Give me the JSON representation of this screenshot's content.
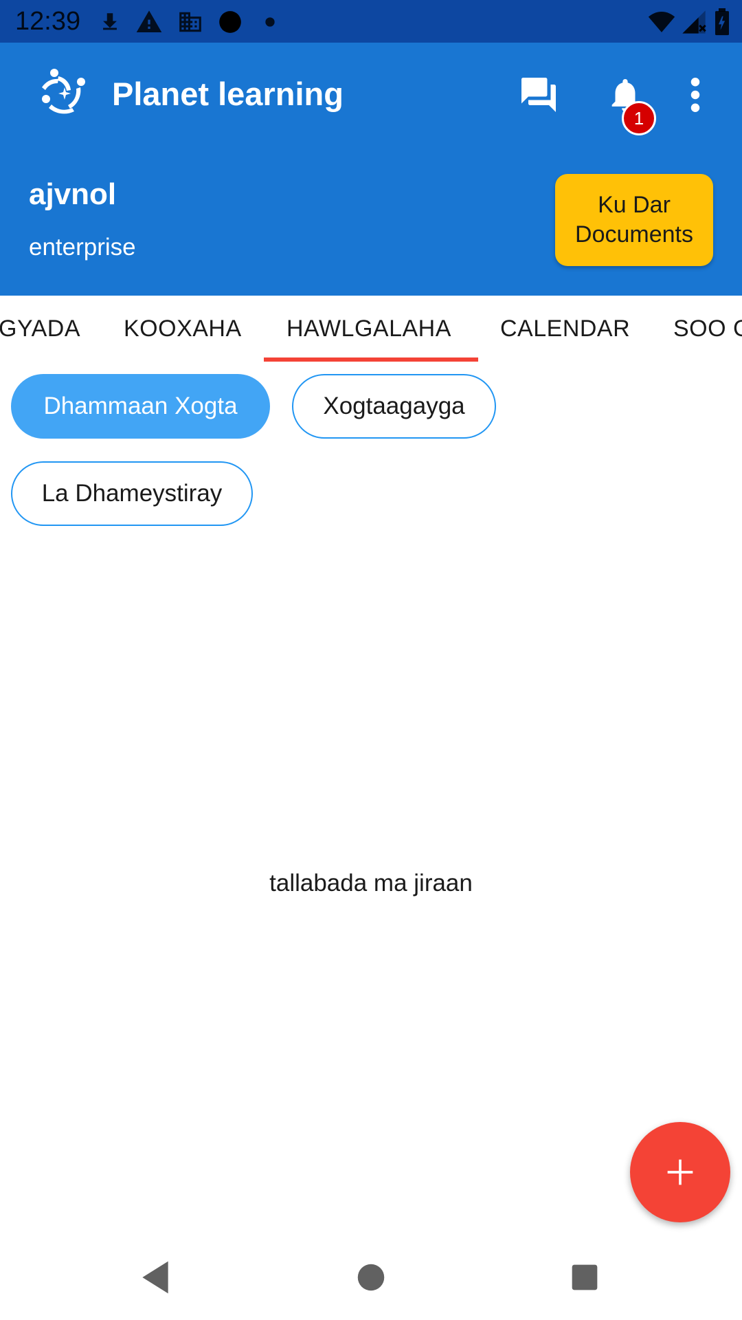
{
  "status_bar": {
    "time": "12:39",
    "icons": [
      "download-icon",
      "warning-icon",
      "building-icon",
      "circle-icon",
      "dot-icon",
      "wifi-icon",
      "signal-icon",
      "battery-icon"
    ]
  },
  "app_bar": {
    "title": "Planet learning",
    "logo_icon": "planet-learning-logo",
    "actions": [
      "chat-icon",
      "notifications-icon",
      "more-vert-icon"
    ],
    "notification_count": "1",
    "username": "ajvnol",
    "plan": "enterprise",
    "documents_button": {
      "line1": "Ku Dar",
      "line2": "Documents"
    }
  },
  "tabs": {
    "items": [
      {
        "label": "GYADA"
      },
      {
        "label": "KOOXAHA"
      },
      {
        "label": "HAWLGALAHA"
      },
      {
        "label": "CALENDAR"
      },
      {
        "label": "SOO G"
      }
    ],
    "selected": "HAWLGALAHA"
  },
  "filters": {
    "items": [
      {
        "label": "Dhammaan Xogta"
      },
      {
        "label": "Xogtaagayga"
      },
      {
        "label": "La Dhameystiray"
      }
    ],
    "selected": "Dhammaan Xogta"
  },
  "main": {
    "empty_message": "tallabada ma jiraan"
  },
  "fab": {
    "icon": "add-icon"
  },
  "nav_bar": {
    "icons": [
      "back-icon",
      "home-icon",
      "recents-icon"
    ]
  },
  "colors": {
    "status_bar": "#0d47a1",
    "app_bar": "#1976d2",
    "accent_yellow": "#ffc107",
    "chip_blue": "#42a5f5",
    "tab_indicator": "#f44336",
    "fab": "#f44336",
    "badge": "#d50000"
  }
}
